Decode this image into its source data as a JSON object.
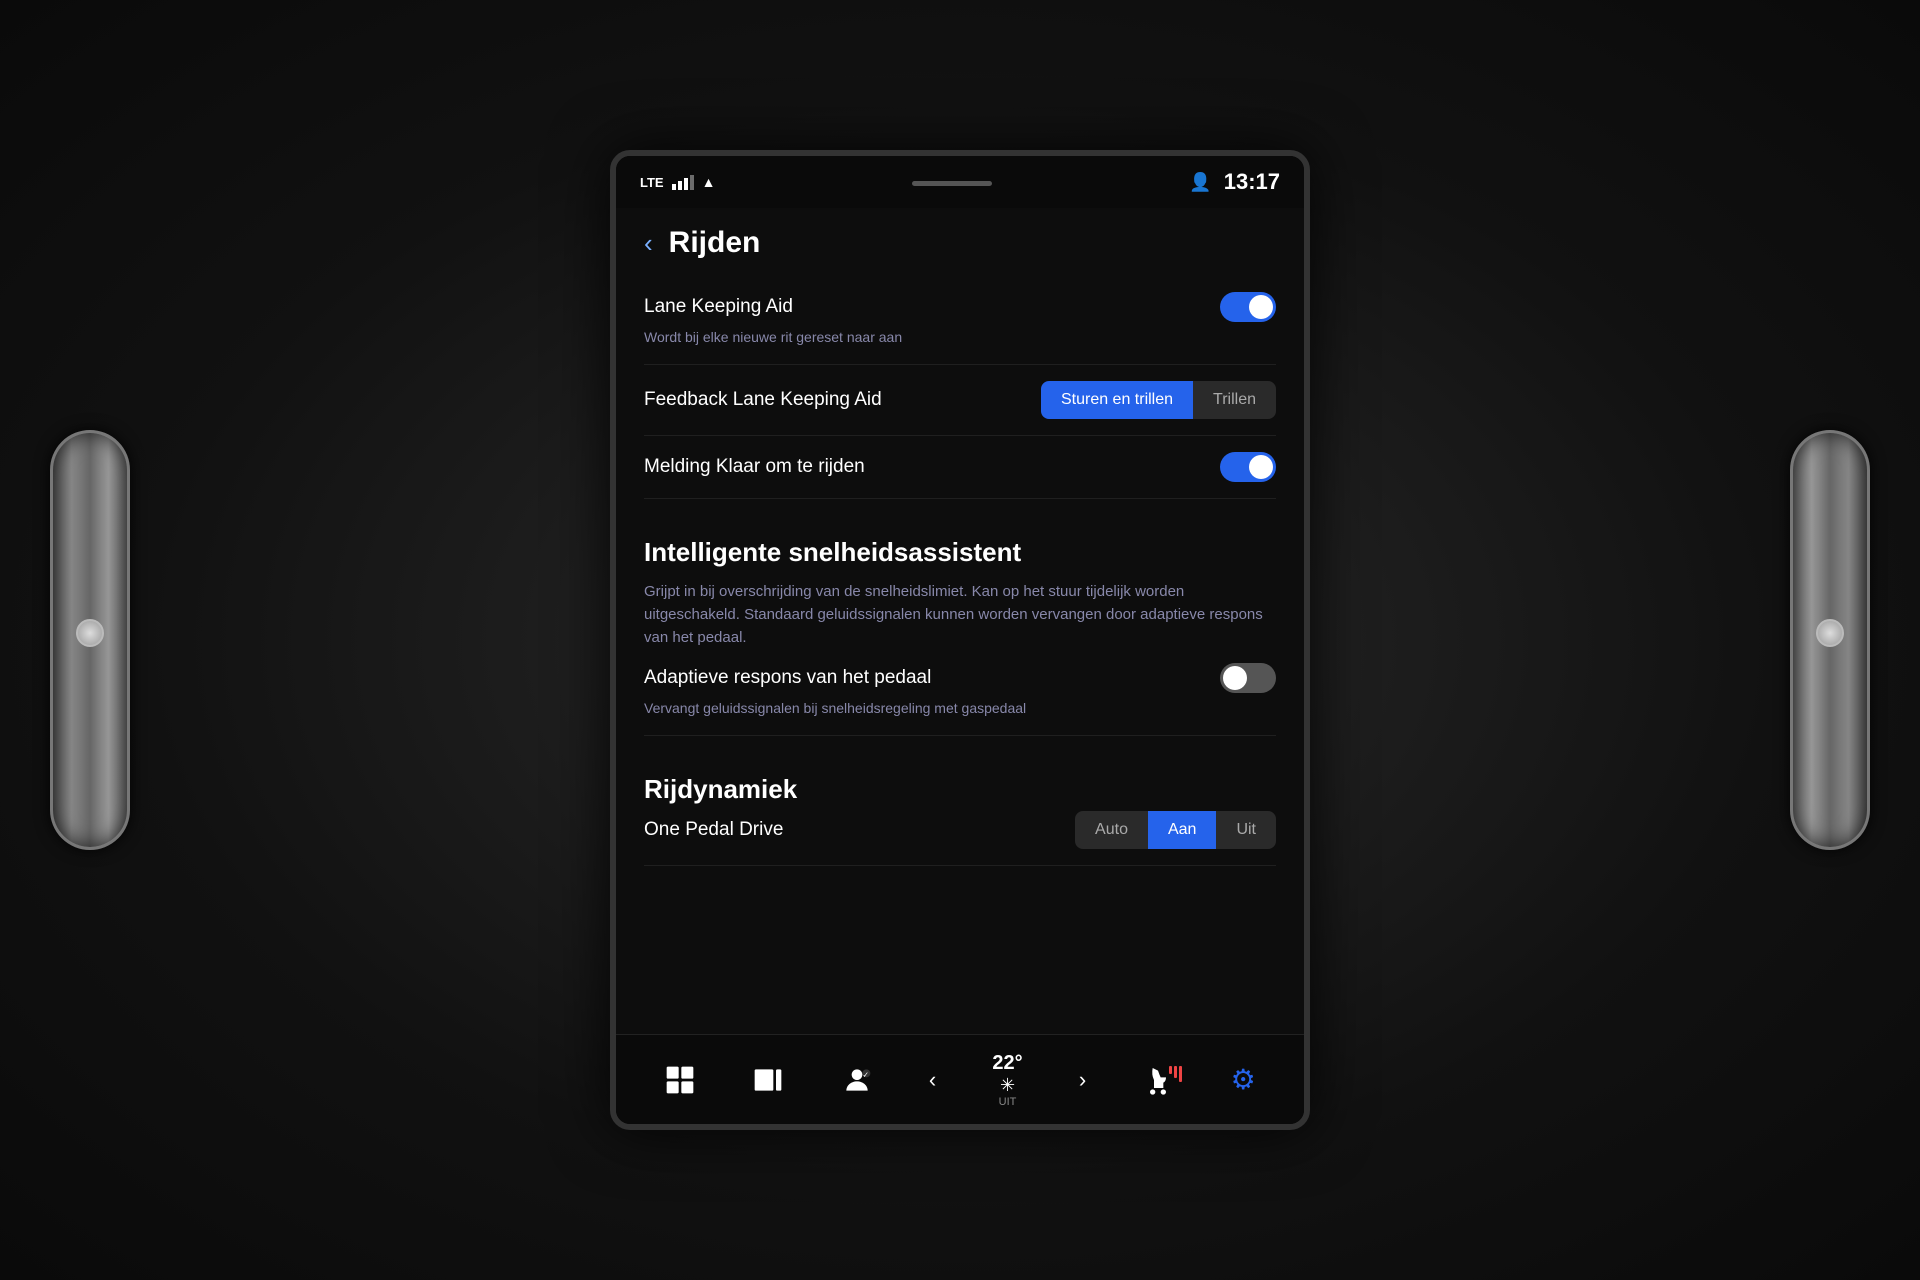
{
  "statusBar": {
    "lte": "LTE",
    "time": "13:17"
  },
  "header": {
    "backLabel": "‹",
    "title": "Rijden"
  },
  "settings": {
    "laneKeepingAid": {
      "label": "Lane Keeping Aid",
      "sublabel": "Wordt bij elke nieuwe rit gereset naar aan",
      "enabled": true
    },
    "feedbackLaneKeepingAid": {
      "label": "Feedback Lane Keeping Aid",
      "options": [
        "Sturen en trillen",
        "Trillen"
      ],
      "activeOption": 0
    },
    "meldingKlaar": {
      "label": "Melding Klaar om te rijden",
      "enabled": true
    },
    "intelligentSpeedAssist": {
      "sectionTitle": "Intelligente snelheidsassistent",
      "description": "Grijpt in bij overschrijding van de snelheidslimiet. Kan op het stuur tijdelijk worden uitgeschakeld. Standaard geluidssignalen kunnen worden vervangen door adaptieve respons van het pedaal.",
      "adaptivePedalResponse": {
        "label": "Adaptieve respons van het pedaal",
        "sublabel": "Vervangt geluidssignalen bij snelheidsregeling met gaspedaal",
        "enabled": false
      }
    },
    "rijdynamiek": {
      "sectionTitle": "Rijdynamiek",
      "onePedalDrive": {
        "label": "One Pedal Drive",
        "options": [
          "Auto",
          "Aan",
          "Uit"
        ],
        "activeOption": 1
      }
    }
  },
  "bottomBar": {
    "temperature": "22°",
    "tempSublabel": "UIT",
    "gearIcon": "⚙"
  }
}
